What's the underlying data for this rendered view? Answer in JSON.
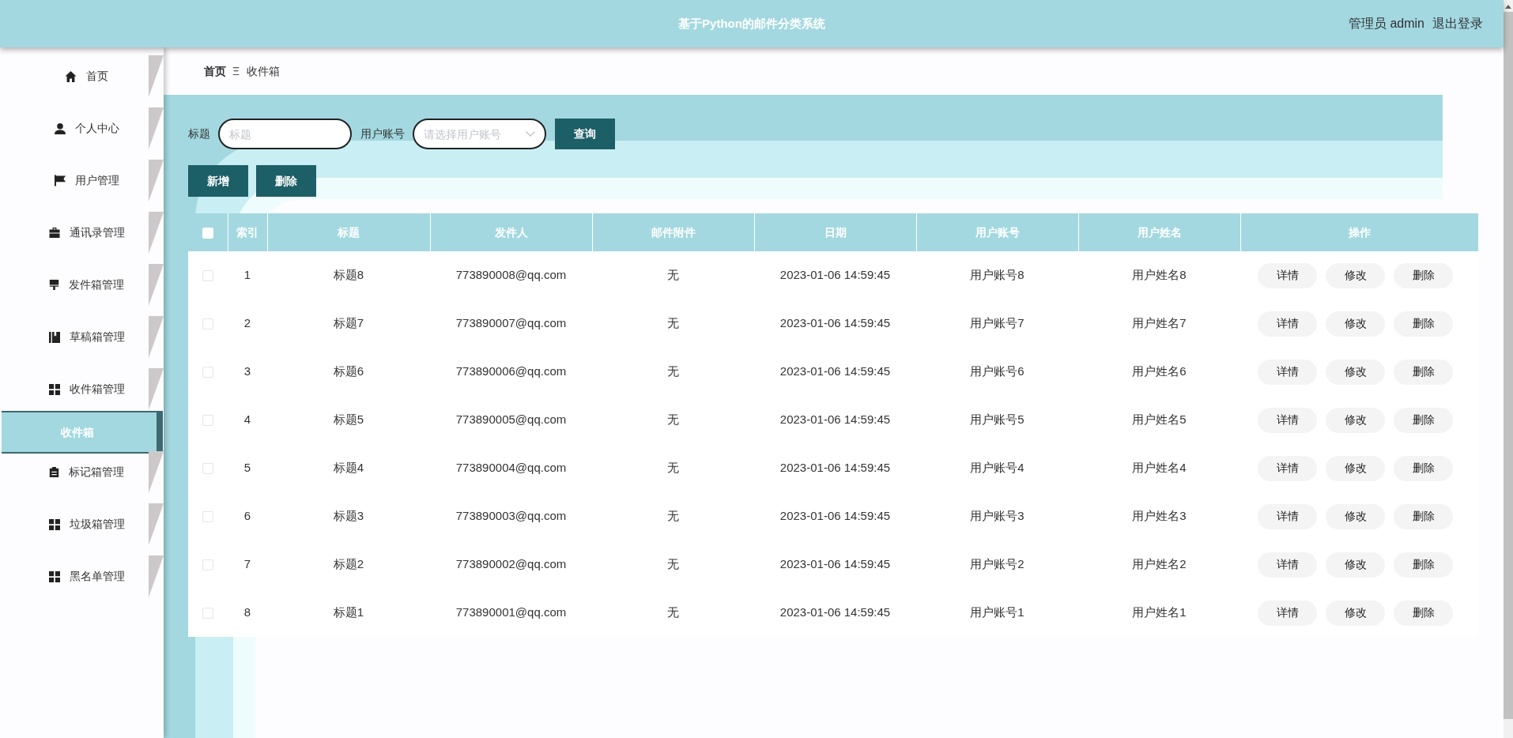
{
  "header": {
    "title": "基于Python的邮件分类系统",
    "user": "管理员 admin",
    "logout": "退出登录"
  },
  "sidebar": {
    "items": [
      {
        "label": "首页",
        "selected": false
      },
      {
        "label": "个人中心",
        "selected": false
      },
      {
        "label": "用户管理",
        "selected": false
      },
      {
        "label": "通讯录管理",
        "selected": false
      },
      {
        "label": "发件箱管理",
        "selected": false
      },
      {
        "label": "草稿箱管理",
        "selected": false
      },
      {
        "label": "收件箱管理",
        "selected": false,
        "children": [
          {
            "label": "收件箱",
            "selected": true
          }
        ]
      },
      {
        "label": "标记箱管理",
        "selected": false
      },
      {
        "label": "垃圾箱管理",
        "selected": false
      },
      {
        "label": "黑名单管理",
        "selected": false
      }
    ]
  },
  "breadcrumb": {
    "separator": "Ξ",
    "items": [
      "首页",
      "收件箱"
    ]
  },
  "search": {
    "fields": [
      {
        "kind": "text",
        "label": "标题",
        "placeholder": "标题"
      },
      {
        "kind": "select",
        "label": "用户账号",
        "placeholder": "请选择用户账号"
      }
    ],
    "button": "查询"
  },
  "toolbar": [
    "新增",
    "删除"
  ],
  "table": {
    "select_all": {
      "checked": false
    },
    "columns": [
      "索引",
      "标题",
      "发件人",
      "邮件附件",
      "日期",
      "用户账号",
      "用户姓名",
      "操作"
    ],
    "rows": [
      {
        "checked": false,
        "cells": [
          "1",
          "标题8",
          "773890008@qq.com",
          "无",
          "2023-01-06 14:59:45",
          "用户账号8",
          "用户姓名8"
        ],
        "actions": [
          "详情",
          "修改",
          "删除"
        ]
      },
      {
        "checked": false,
        "cells": [
          "2",
          "标题7",
          "773890007@qq.com",
          "无",
          "2023-01-06 14:59:45",
          "用户账号7",
          "用户姓名7"
        ],
        "actions": [
          "详情",
          "修改",
          "删除"
        ]
      },
      {
        "checked": false,
        "cells": [
          "3",
          "标题6",
          "773890006@qq.com",
          "无",
          "2023-01-06 14:59:45",
          "用户账号6",
          "用户姓名6"
        ],
        "actions": [
          "详情",
          "修改",
          "删除"
        ]
      },
      {
        "checked": false,
        "cells": [
          "4",
          "标题5",
          "773890005@qq.com",
          "无",
          "2023-01-06 14:59:45",
          "用户账号5",
          "用户姓名5"
        ],
        "actions": [
          "详情",
          "修改",
          "删除"
        ]
      },
      {
        "checked": false,
        "cells": [
          "5",
          "标题4",
          "773890004@qq.com",
          "无",
          "2023-01-06 14:59:45",
          "用户账号4",
          "用户姓名4"
        ],
        "actions": [
          "详情",
          "修改",
          "删除"
        ]
      },
      {
        "checked": false,
        "cells": [
          "6",
          "标题3",
          "773890003@qq.com",
          "无",
          "2023-01-06 14:59:45",
          "用户账号3",
          "用户姓名3"
        ],
        "actions": [
          "详情",
          "修改",
          "删除"
        ]
      },
      {
        "checked": false,
        "cells": [
          "7",
          "标题2",
          "773890002@qq.com",
          "无",
          "2023-01-06 14:59:45",
          "用户账号2",
          "用户姓名2"
        ],
        "actions": [
          "详情",
          "修改",
          "删除"
        ]
      },
      {
        "checked": false,
        "cells": [
          "8",
          "标题1",
          "773890001@qq.com",
          "无",
          "2023-01-06 14:59:45",
          "用户账号1",
          "用户姓名1"
        ],
        "actions": [
          "详情",
          "修改",
          "删除"
        ]
      }
    ]
  }
}
